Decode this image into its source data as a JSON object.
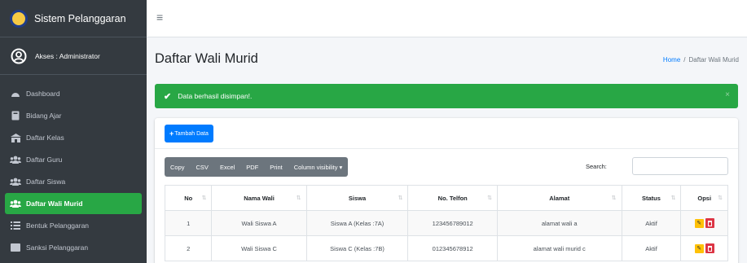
{
  "brand": {
    "title": "Sistem Pelanggaran"
  },
  "user": {
    "label": "Akses : Administrator"
  },
  "sidebar": {
    "items": [
      {
        "label": "Dashboard",
        "icon": "dashboard-icon",
        "active": false
      },
      {
        "label": "Bidang Ajar",
        "icon": "book-icon",
        "active": false
      },
      {
        "label": "Daftar Kelas",
        "icon": "school-icon",
        "active": false
      },
      {
        "label": "Daftar Guru",
        "icon": "users-icon",
        "active": false
      },
      {
        "label": "Daftar Siswa",
        "icon": "users-icon",
        "active": false
      },
      {
        "label": "Daftar Wali Murid",
        "icon": "users-icon",
        "active": true
      },
      {
        "label": "Bentuk Pelanggaran",
        "icon": "list-icon",
        "active": false
      },
      {
        "label": "Sanksi Pelanggaran",
        "icon": "list-icon",
        "active": false
      }
    ]
  },
  "page": {
    "title": "Daftar Wali Murid",
    "breadcrumb": {
      "home": "Home",
      "separator": "/",
      "current": "Daftar Wali Murid"
    }
  },
  "alert": {
    "message": "Data berhasil disimpan!.",
    "close": "×"
  },
  "toolbar": {
    "add_label": "Tambah Data",
    "export_buttons": [
      "Copy",
      "CSV",
      "Excel",
      "PDF",
      "Print",
      "Column visibility ▾"
    ],
    "search_label": "Search:",
    "search_value": ""
  },
  "table": {
    "headers": [
      "No",
      "Nama Wali",
      "Siswa",
      "No. Telfon",
      "Alamat",
      "Status",
      "Opsi"
    ],
    "rows": [
      {
        "no": "1",
        "nama": "Wali Siswa A",
        "siswa": "Siswa A (Kelas :7A)",
        "telfon": "123456789012",
        "alamat": "alamat wali a",
        "status": "Aktif"
      },
      {
        "no": "2",
        "nama": "Wali Siswa C",
        "siswa": "Siswa C (Kelas :7B)",
        "telfon": "012345678912",
        "alamat": "alamat wali murid c",
        "status": "Aktif"
      }
    ]
  },
  "colors": {
    "sidebar_bg": "#343a40",
    "active_green": "#28a745",
    "primary_blue": "#007bff",
    "export_gray": "#6c757d",
    "edit_yellow": "#ffc107",
    "delete_red": "#dc3545"
  }
}
